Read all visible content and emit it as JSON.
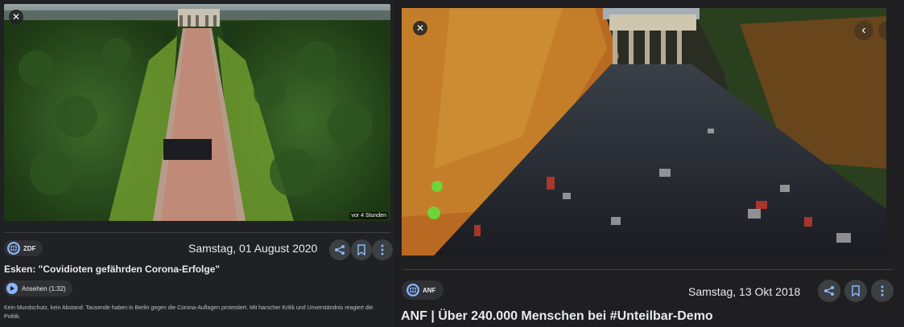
{
  "left_card": {
    "time_ago": "vor 4 Stunden",
    "source": "ZDF",
    "date": "Samstag, 01 August 2020",
    "title": "Esken: \"Covidioten gefährden Corona-Erfolge\"",
    "watch_label": "Ansehen (1:32)",
    "description": "Kein Mundschutz, kein Abstand: Tausende haben in Berlin gegen die Corona-Auflagen protestiert. Mit harscher Kritik und Unverständnis reagiert die Politik.",
    "icons": [
      "close-icon",
      "globe-icon",
      "share-icon",
      "bookmark-icon",
      "more-vert-icon",
      "play-icon"
    ]
  },
  "right_card": {
    "source": "ANF",
    "date": "Samstag, 13 Okt 2018",
    "title": "ANF | Über 240.000 Menschen bei #Unteilbar-Demo",
    "icons": [
      "close-icon",
      "chevron-left-icon",
      "chevron-right-icon",
      "globe-icon",
      "share-icon",
      "bookmark-icon",
      "more-vert-icon"
    ]
  },
  "colors": {
    "background": "#202124",
    "surface": "#303134",
    "accent": "#8ab4f8",
    "text": "#e8eaed"
  }
}
